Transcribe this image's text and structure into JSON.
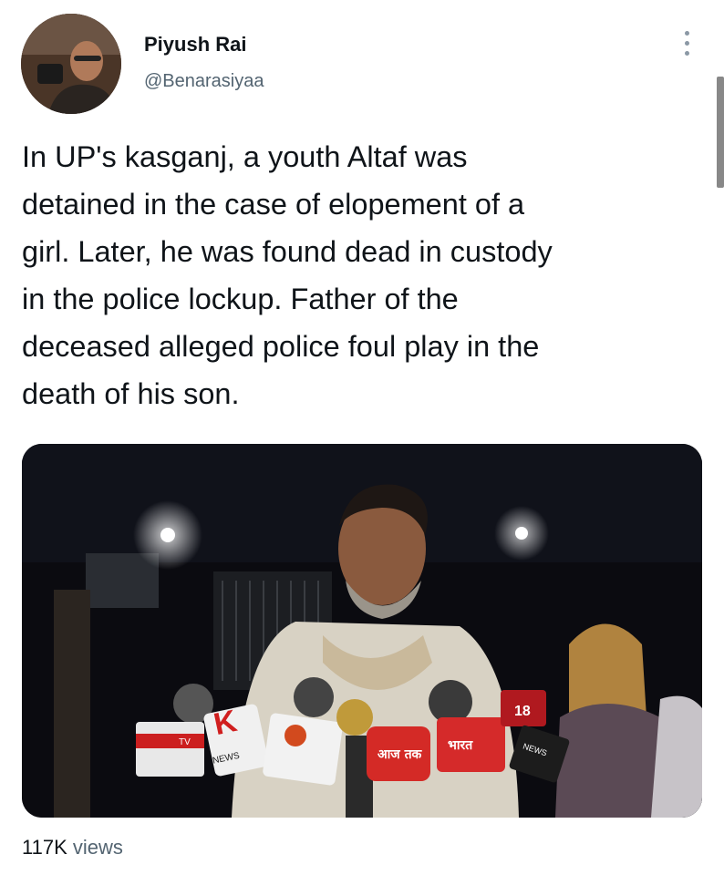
{
  "author": {
    "name": "Piyush Rai",
    "handle": "@Benarasiyaa"
  },
  "tweet": {
    "text": "In UP's kasganj, a youth Altaf was\ndetained in the case of elopement of a\ngirl. Later, he was found dead in custody\nin the police lockup. Father of the\ndeceased alleged police foul play in the\ndeath of his son.",
    "views_count": "117K",
    "views_label": " views"
  },
  "media": {
    "mic_labels": [
      "TV",
      "K",
      "NEWS",
      "आज तक",
      "भारत",
      "18",
      "NEWS"
    ]
  },
  "icons": {
    "more": "more-vertical-icon"
  },
  "colors": {
    "text": "#0f1419",
    "secondary": "#536471"
  }
}
